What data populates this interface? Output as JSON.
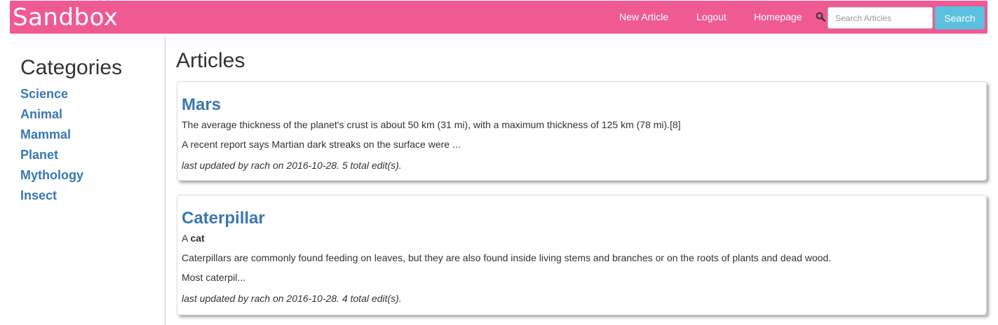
{
  "navbar": {
    "brand": "Sandbox",
    "links": [
      "New Article",
      "Logout",
      "Homepage"
    ],
    "search": {
      "placeholder": "Search Articles",
      "value": "",
      "button_label": "Search"
    },
    "colors": {
      "background": "#f05a93",
      "search_button": "#5bc0de"
    }
  },
  "sidebar": {
    "title": "Categories",
    "items": [
      "Science",
      "Animal",
      "Mammal",
      "Planet",
      "Mythology",
      "Insect"
    ]
  },
  "main": {
    "title": "Articles",
    "articles": [
      {
        "title": "Mars",
        "lines": [
          "The average thickness of the planet's crust is about 50 km (31 mi), with a maximum thickness of 125 km (78 mi).[8]",
          "A recent report says Martian dark streaks on the surface were ..."
        ],
        "meta": "last updated by rach on 2016-10-28. 5 total edit(s)."
      },
      {
        "title": "Caterpillar",
        "intro_prefix": "A ",
        "intro_bold": "cat",
        "lines": [
          "Caterpillars are commonly found feeding on leaves, but they are also found inside living stems and branches or on the roots of plants and dead wood.",
          "Most caterpil..."
        ],
        "meta": "last updated by rach on 2016-10-28. 4 total edit(s)."
      }
    ]
  },
  "icons": {
    "search": "magnifier-icon"
  }
}
